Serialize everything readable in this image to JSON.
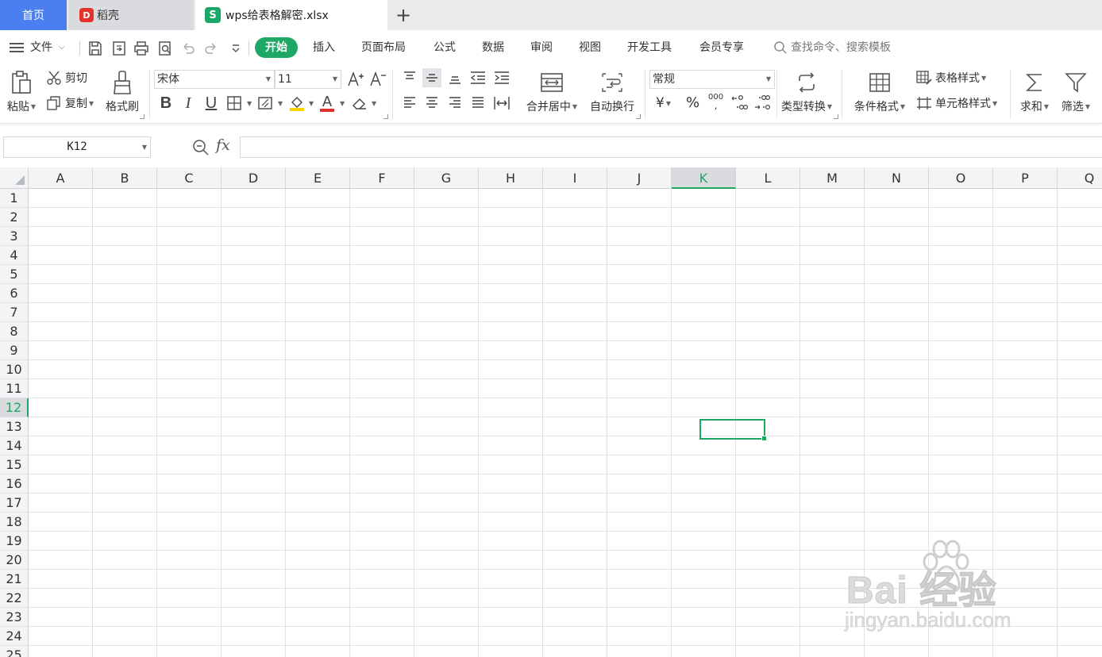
{
  "tabs": {
    "home": "首页",
    "daoke": "稻壳",
    "file": "wps给表格解密.xlsx",
    "daoke_logo": "D",
    "file_logo": "S"
  },
  "menu": {
    "file": "文件",
    "items": [
      "开始",
      "插入",
      "页面布局",
      "公式",
      "数据",
      "审阅",
      "视图",
      "开发工具",
      "会员专享"
    ],
    "search": "查找命令、搜索模板"
  },
  "ribbon": {
    "paste": "粘贴",
    "cut": "剪切",
    "copy": "复制",
    "format_painter": "格式刷",
    "font_name": "宋体",
    "font_size": "11",
    "merge_center": "合并居中",
    "wrap_text": "自动换行",
    "number_format": "常规",
    "type_convert": "类型转换",
    "conditional_format": "条件格式",
    "table_style": "表格样式",
    "cell_style": "单元格样式",
    "sum": "求和",
    "filter": "筛选",
    "currency_symbol": "¥",
    "percent_symbol": "%",
    "thousands_symbol": "000",
    "bold_label": "B",
    "italic_label": "I",
    "underline_label": "U",
    "font_color_label": "A"
  },
  "formula_bar": {
    "name_box": "K12",
    "fx": "fx",
    "formula": ""
  },
  "grid": {
    "columns": [
      "A",
      "B",
      "C",
      "D",
      "E",
      "F",
      "G",
      "H",
      "I",
      "J",
      "K",
      "L",
      "M",
      "N",
      "O",
      "P",
      "Q"
    ],
    "rows": [
      "1",
      "2",
      "3",
      "4",
      "5",
      "6",
      "7",
      "8",
      "9",
      "10",
      "11",
      "12",
      "13",
      "14",
      "15",
      "16",
      "17",
      "18",
      "19",
      "20",
      "21",
      "22",
      "23",
      "24",
      "25"
    ],
    "selected_column": "K",
    "selected_row": "12"
  },
  "watermark": {
    "line1": "Bai  经验",
    "line2": "jingyan.baidu.com"
  },
  "colors": {
    "accent": "#1ea765",
    "home_tab": "#4b7ff0",
    "daoke_red": "#e5322d"
  }
}
